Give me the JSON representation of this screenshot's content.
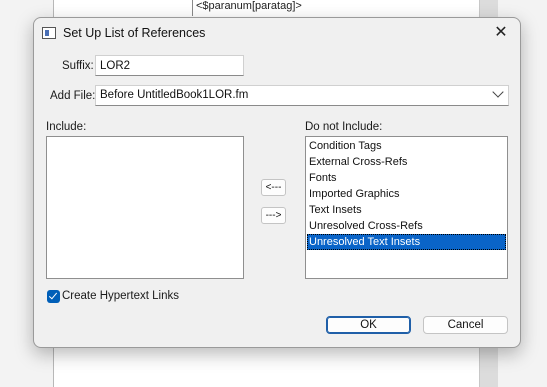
{
  "background": {
    "paragraph_tag": "<$paranum[paratag]>"
  },
  "dialog": {
    "title": "Set Up List of References",
    "close_icon": "close-icon",
    "suffix_label": "Suffix:",
    "suffix_value": "LOR2",
    "addfile_label": "Add File:",
    "addfile_value": "Before UntitledBook1LOR.fm",
    "include_label": "Include:",
    "include_items": [],
    "exclude_label": "Do not Include:",
    "exclude_items": [
      "Condition Tags",
      "External Cross-Refs",
      "Fonts",
      "Imported Graphics",
      "Text Insets",
      "Unresolved Cross-Refs",
      "Unresolved Text Insets"
    ],
    "selected_exclude_item": "Unresolved Text Insets",
    "move_left_label": "<---",
    "move_right_label": "--->",
    "hypertext_label": "Create Hypertext Links",
    "hypertext_checked": true,
    "ok_label": "OK",
    "cancel_label": "Cancel"
  },
  "colors": {
    "selection": "#0a64c8",
    "checkbox": "#005fb8",
    "dialog_bg": "#f0f0f0"
  }
}
